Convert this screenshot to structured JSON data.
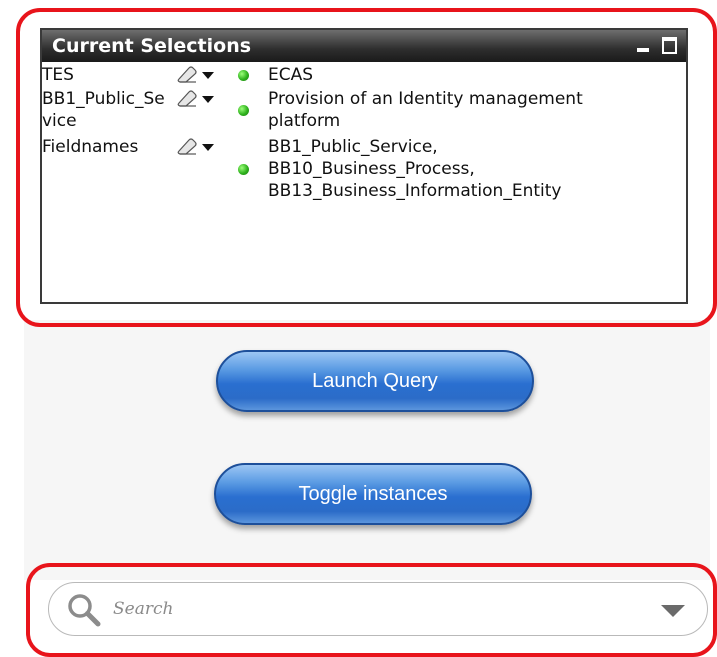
{
  "current_selections": {
    "title": "Current Selections",
    "rows": [
      {
        "field": "TES",
        "values": [
          "ECAS"
        ]
      },
      {
        "field": "BB1_Public_Service",
        "field_visible_line1": "BB1_Public_Se",
        "field_visible_line2": "vice",
        "values": [
          "Provision of an Identity management",
          "platform"
        ]
      },
      {
        "field": "Fieldnames",
        "values": [
          "BB1_Public_Service,",
          "BB10_Business_Process,",
          "BB13_Business_Information_Entity"
        ]
      }
    ]
  },
  "buttons": {
    "launch_query": "Launch Query",
    "toggle_instances": "Toggle instances"
  },
  "search": {
    "placeholder": "Search"
  },
  "colors": {
    "highlight_frame": "#e8141b",
    "button_blue": "#2a6fd0",
    "status_green": "#2fb21d",
    "title_bar": "#2e2e2e"
  }
}
